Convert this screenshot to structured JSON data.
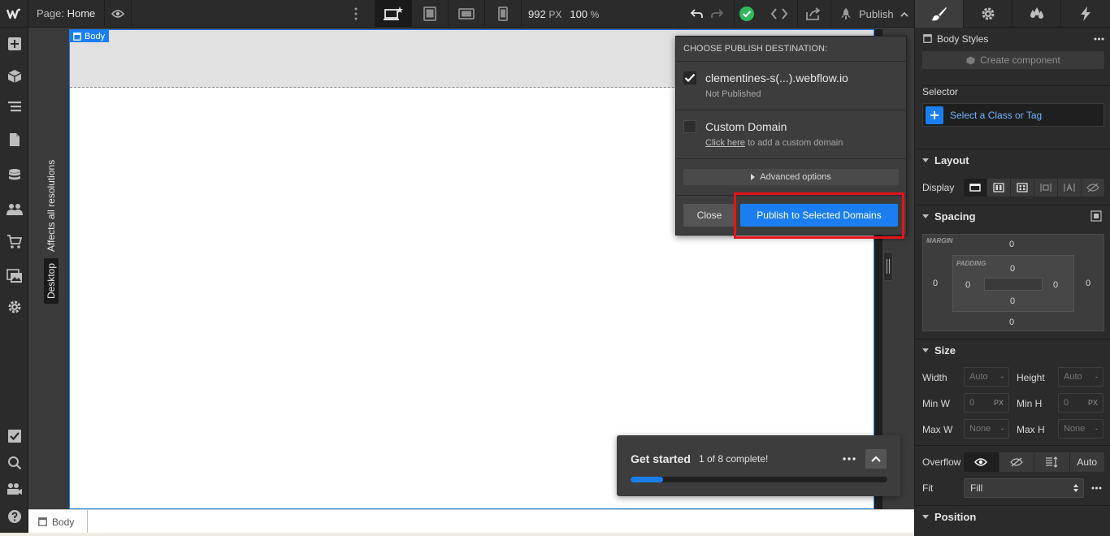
{
  "topbar": {
    "page_prefix": "Page:",
    "page_name": "Home",
    "width_value": "992",
    "width_unit": "PX",
    "zoom_value": "100",
    "zoom_unit": "%",
    "publish_label": "Publish"
  },
  "canvas": {
    "resolution_badge": "Desktop",
    "resolution_text": "Affects all resolutions",
    "selected_tag": "Body"
  },
  "publish_popup": {
    "title": "CHOOSE PUBLISH DESTINATION:",
    "destinations": [
      {
        "name": "clementines-s(...).webflow.io",
        "sub": "Not Published",
        "checked": true
      },
      {
        "name": "Custom Domain",
        "sub_link": "Click here",
        "sub_rest": " to add a custom domain",
        "checked": false
      }
    ],
    "advanced_label": "Advanced options",
    "close_label": "Close",
    "publish_selected_label": "Publish to Selected Domains"
  },
  "get_started": {
    "title": "Get started",
    "progress_text": "1 of 8 complete!",
    "progress_fraction": 0.125
  },
  "breadcrumb": {
    "item": "Body"
  },
  "right_panel": {
    "styles_title": "Body Styles",
    "create_component_label": "Create component",
    "selector_label": "Selector",
    "selector_placeholder": "Select a Class or Tag",
    "layout_title": "Layout",
    "display_label": "Display",
    "spacing_title": "Spacing",
    "margin_label": "MARGIN",
    "padding_label": "PADDING",
    "margin": {
      "top": "0",
      "right": "0",
      "bottom": "0",
      "left": "0"
    },
    "padding": {
      "top": "0",
      "right": "0",
      "bottom": "0",
      "left": "0"
    },
    "size_title": "Size",
    "width_label": "Width",
    "width_value": "Auto",
    "height_label": "Height",
    "height_value": "Auto",
    "min_w_label": "Min W",
    "min_w_value": "0",
    "min_h_label": "Min H",
    "min_h_value": "0",
    "max_w_label": "Max W",
    "max_w_value": "None",
    "max_h_label": "Max H",
    "max_h_value": "None",
    "dash": "-",
    "unit_px": "PX",
    "overflow_label": "Overflow",
    "overflow_auto": "Auto",
    "fit_label": "Fit",
    "fit_value": "Fill",
    "position_title": "Position"
  },
  "colors": {
    "accent": "#1a7ef0",
    "highlight": "#e8121b",
    "success": "#2fba5b"
  }
}
